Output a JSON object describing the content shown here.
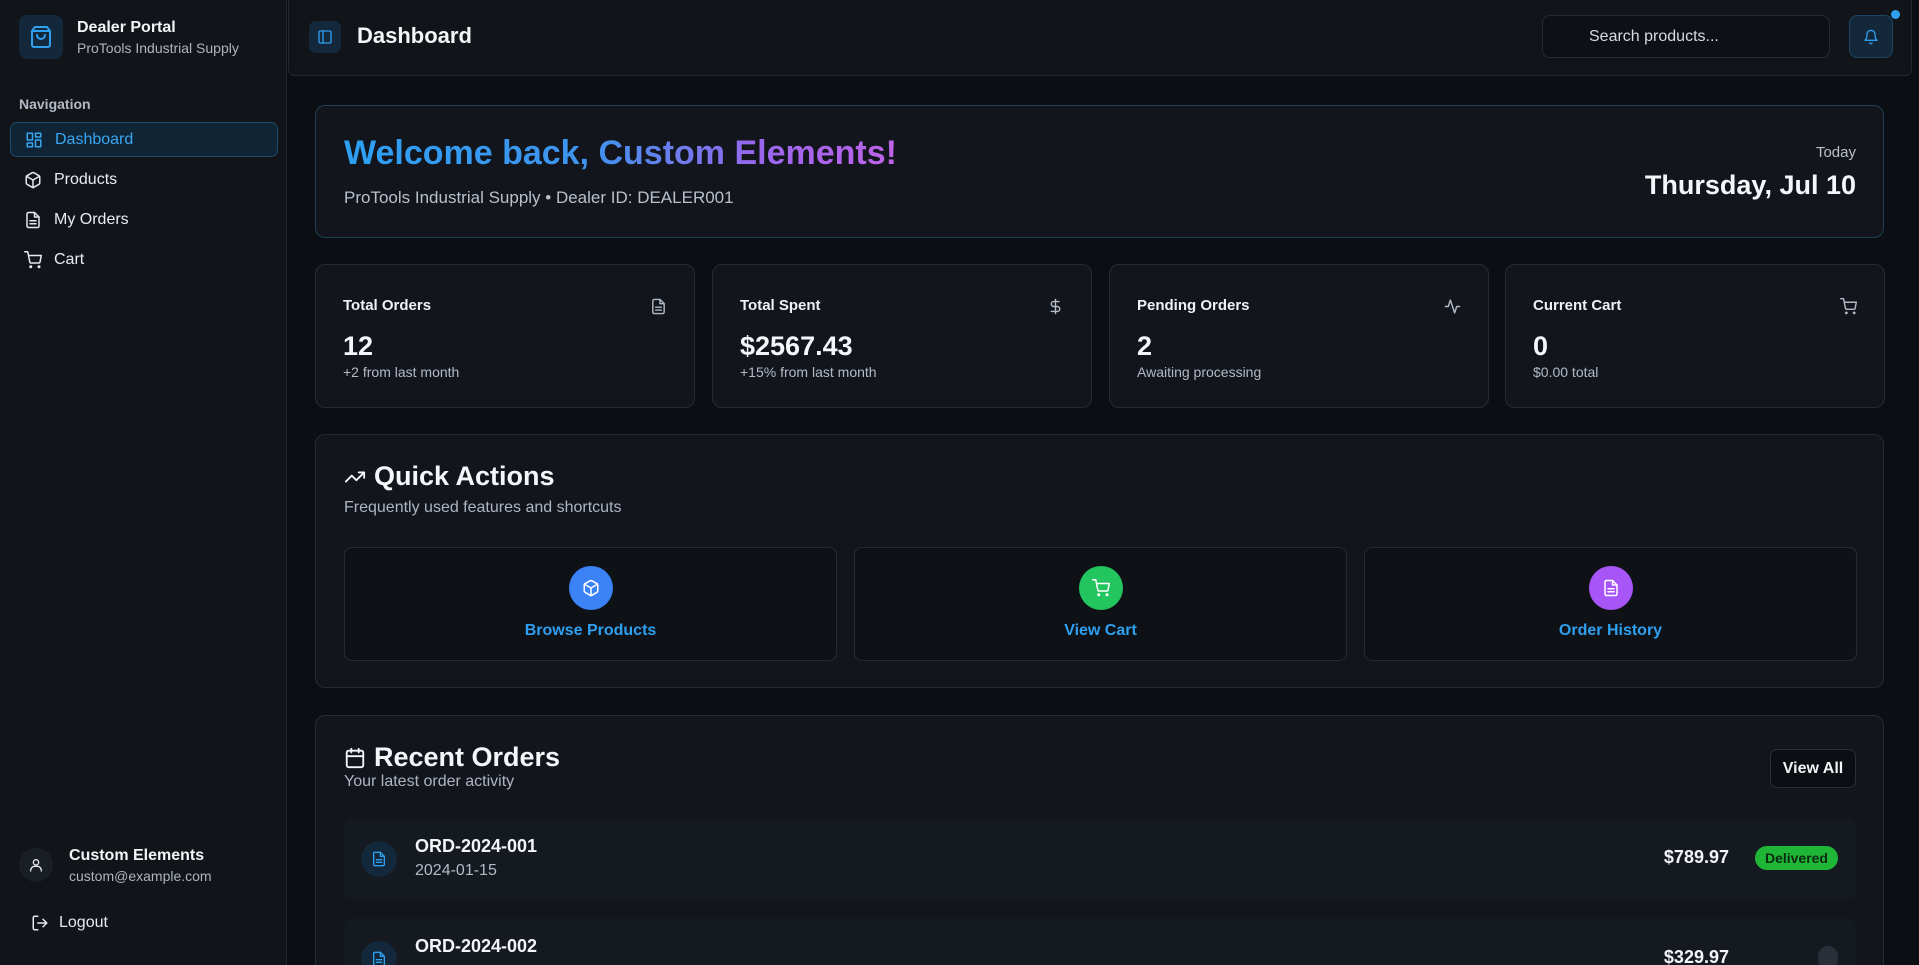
{
  "sidebar": {
    "brand_title": "Dealer Portal",
    "brand_subtitle": "ProTools Industrial Supply",
    "nav_label": "Navigation",
    "items": [
      {
        "label": "Dashboard",
        "icon": "dashboard-icon",
        "active": true
      },
      {
        "label": "Products",
        "icon": "package-icon",
        "active": false
      },
      {
        "label": "My Orders",
        "icon": "file-text-icon",
        "active": false
      },
      {
        "label": "Cart",
        "icon": "cart-icon",
        "active": false
      }
    ],
    "user": {
      "name": "Custom Elements",
      "email": "custom@example.com"
    },
    "logout_label": "Logout"
  },
  "header": {
    "title": "Dashboard",
    "search_placeholder": "Search products...",
    "notifications_unread": true
  },
  "welcome": {
    "title": "Welcome back, Custom Elements!",
    "subtitle": "ProTools Industrial Supply • Dealer ID: DEALER001",
    "today_label": "Today",
    "today_date": "Thursday, Jul 10"
  },
  "stats": [
    {
      "label": "Total Orders",
      "value": "12",
      "note": "+2 from last month",
      "icon": "file-text-icon"
    },
    {
      "label": "Total Spent",
      "value": "$2567.43",
      "note": "+15% from last month",
      "icon": "dollar-icon"
    },
    {
      "label": "Pending Orders",
      "value": "2",
      "note": "Awaiting processing",
      "icon": "activity-icon"
    },
    {
      "label": "Current Cart",
      "value": "0",
      "note": "$0.00 total",
      "icon": "cart-icon"
    }
  ],
  "quick_actions": {
    "title": "Quick Actions",
    "subtitle": "Frequently used features and shortcuts",
    "items": [
      {
        "label": "Browse Products",
        "icon": "package-icon",
        "color": "#3b82f6"
      },
      {
        "label": "View Cart",
        "icon": "cart-icon",
        "color": "#22c55e"
      },
      {
        "label": "Order History",
        "icon": "file-text-icon",
        "color": "#a855f7"
      }
    ]
  },
  "recent_orders": {
    "title": "Recent Orders",
    "subtitle": "Your latest order activity",
    "view_all_label": "View All",
    "orders": [
      {
        "id": "ORD-2024-001",
        "date": "2024-01-15",
        "amount": "$789.97",
        "status": "Delivered"
      },
      {
        "id": "ORD-2024-002",
        "date": "",
        "amount": "$329.97",
        "status": ""
      }
    ]
  },
  "colors": {
    "accent": "#2f9ff0",
    "delivered": "#1fb536",
    "background": "#0b0f14",
    "surface": "#12161c"
  }
}
